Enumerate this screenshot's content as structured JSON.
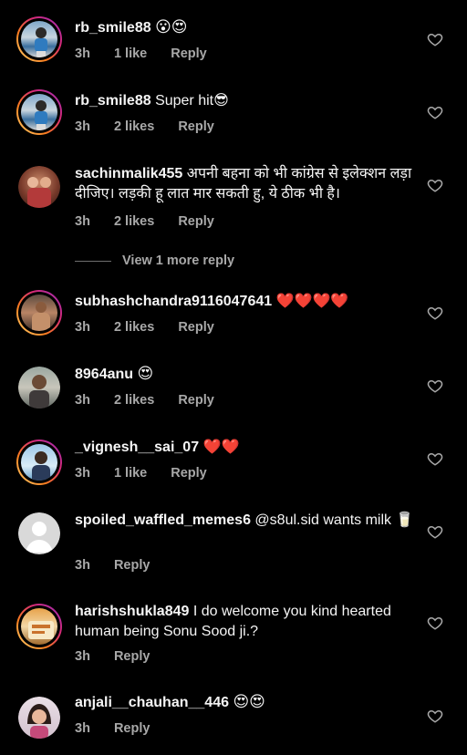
{
  "comments": [
    {
      "username": "rb_smile88",
      "text": "😮😍",
      "time": "3h",
      "likes": "1 like",
      "reply": "Reply"
    },
    {
      "username": "rb_smile88",
      "text": "Super hit😎",
      "time": "3h",
      "likes": "2 likes",
      "reply": "Reply"
    },
    {
      "username": "sachinmalik455",
      "text": "अपनी बहना को भी कांग्रेस से इलेक्शन लड़ा दीजिए। लड़की हू लात मार सकती हु, ये ठीक भी है।",
      "time": "3h",
      "likes": "2 likes",
      "reply": "Reply"
    },
    {
      "username": "subhashchandra9116047641",
      "text": "❤️❤️❤️❤️",
      "time": "3h",
      "likes": "2 likes",
      "reply": "Reply"
    },
    {
      "username": "8964anu",
      "text": "😍",
      "time": "3h",
      "likes": "2 likes",
      "reply": "Reply"
    },
    {
      "username": "_vignesh__sai_07",
      "text": "❤️❤️",
      "time": "3h",
      "likes": "1 like",
      "reply": "Reply"
    },
    {
      "username": "spoiled_waffled_memes6",
      "text": "@s8ul.sid wants milk 🥛",
      "time": "3h",
      "reply": "Reply"
    },
    {
      "username": "harishshukla849",
      "text": "I do welcome you  kind hearted human being Sonu Sood ji.?",
      "time": "3h",
      "reply": "Reply"
    },
    {
      "username": "anjali__chauhan__446",
      "text": "😍😍",
      "time": "3h",
      "reply": "Reply"
    }
  ],
  "view_more": "View 1 more reply",
  "icons": {
    "like": "heart-outline-icon"
  },
  "colors": {
    "background": "#000000",
    "text": "#f5f5f5",
    "muted": "#a8a8a8"
  }
}
